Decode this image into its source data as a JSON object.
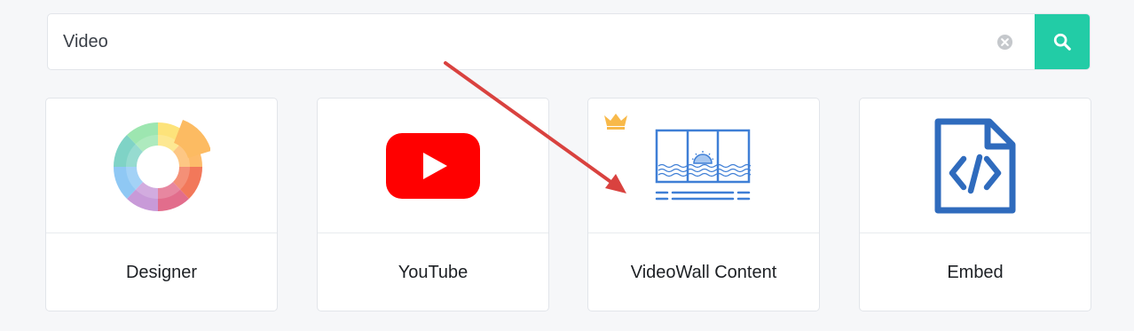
{
  "search": {
    "value": "Video",
    "clear_icon": "clear-icon",
    "button_icon": "search-icon",
    "accent_color": "#22cca6"
  },
  "cards": [
    {
      "label": "Designer",
      "icon": "designer-color-wheel-icon",
      "premium": false
    },
    {
      "label": "YouTube",
      "icon": "youtube-icon",
      "premium": false
    },
    {
      "label": "VideoWall Content",
      "icon": "videowall-icon",
      "premium": true,
      "badge_icon": "crown-icon"
    },
    {
      "label": "Embed",
      "icon": "embed-code-file-icon",
      "premium": false
    }
  ],
  "annotation": {
    "icon": "red-arrow-icon",
    "color": "#d9423f"
  }
}
